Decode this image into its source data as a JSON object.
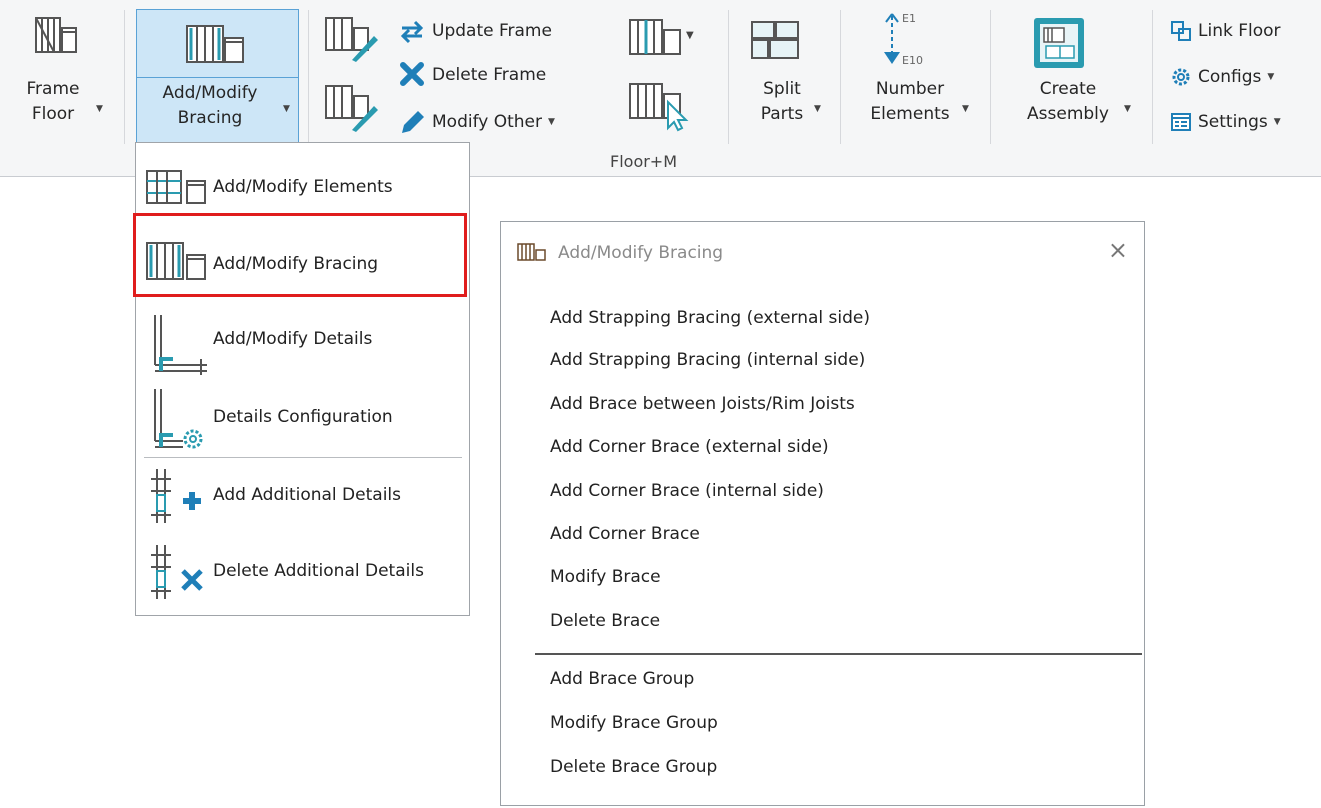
{
  "ribbon": {
    "frame_floor": {
      "line1": "Frame",
      "line2": "Floor"
    },
    "add_modify_bracing": {
      "line1": "Add/Modify",
      "line2": "Bracing"
    },
    "update_frame": "Update Frame",
    "delete_frame": "Delete Frame",
    "modify_other": "Modify Other",
    "panel_label": "Floor+M",
    "split_parts": {
      "line1": "Split",
      "line2": "Parts"
    },
    "number_elements": {
      "line1": "Number",
      "line2": "Elements",
      "top_tag": "E1",
      "bottom_tag": "E10"
    },
    "create_assembly": {
      "line1": "Create",
      "line2": "Assembly"
    },
    "link_floor": "Link Floor",
    "configs": "Configs",
    "settings": "Settings"
  },
  "dropdown": {
    "items": [
      {
        "label": "Add/Modify  Elements",
        "icon": "frame-elements-icon"
      },
      {
        "label": "Add/Modify  Bracing",
        "icon": "bracing-icon",
        "highlighted": true
      },
      {
        "label": "Add/Modify  Details",
        "icon": "details-icon"
      },
      {
        "label": "Details  Configuration",
        "icon": "details-config-icon"
      },
      {
        "label": "Add Additional  Details",
        "icon": "add-details-icon"
      },
      {
        "label": "Delete  Additional Details",
        "icon": "delete-details-icon"
      }
    ]
  },
  "dialog": {
    "title": "Add/Modify Bracing",
    "close": "×",
    "items": [
      "Add Strapping Bracing (external side)",
      "Add Strapping Bracing (internal side)",
      "Add Brace between Joists/Rim Joists",
      "Add Corner Brace (external side)",
      "Add Corner Brace (internal side)",
      "Add Corner Brace",
      "Modify Brace",
      "Delete Brace"
    ],
    "group_items": [
      "Add Brace Group",
      "Modify Brace Group",
      "Delete Brace Group"
    ]
  },
  "colors": {
    "accent": "#2a9bb0",
    "highlight_border": "#e01d1d",
    "selected_button": "#cde6f7"
  }
}
